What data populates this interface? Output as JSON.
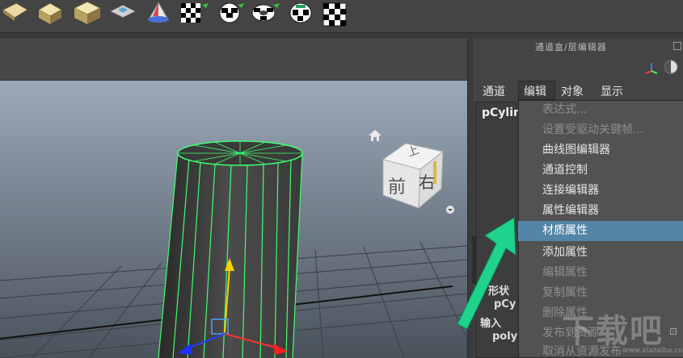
{
  "shelf": {
    "icons": [
      "plane-icon",
      "box-icon",
      "cylinder-icon",
      "uv-plane-icon",
      "cone-icon",
      "checker-uv-icon",
      "checker-sphere-icon",
      "checker-torus-icon",
      "checker-cylinder-icon",
      "checker-square-icon"
    ]
  },
  "channel_box": {
    "title": "通道盒/层编辑器",
    "menus": [
      "通道",
      "编辑",
      "对象",
      "显示"
    ],
    "object_name": "pCylin",
    "shape_label": "形状",
    "shape_name": "pCy",
    "inputs_label": "输入",
    "input_name": "poly"
  },
  "view_cube": {
    "top_label": "上",
    "front_label": "前",
    "right_label": "右"
  },
  "edit_menu": {
    "items": [
      {
        "label": "表达式...",
        "disabled": true
      },
      {
        "label": "设置受驱动关键帧...",
        "disabled": true
      },
      {
        "label": "曲线图编辑器",
        "disabled": false
      },
      {
        "label": "通道控制",
        "disabled": false
      },
      {
        "label": "连接编辑器",
        "disabled": false
      },
      {
        "label": "属性编辑器",
        "disabled": false
      },
      {
        "label": "材质属性",
        "disabled": false,
        "highlighted": true
      },
      {
        "label": "添加属性",
        "disabled": false
      },
      {
        "label": "编辑属性",
        "disabled": true
      },
      {
        "label": "复制属性",
        "disabled": true
      },
      {
        "label": "删除属性",
        "disabled": true
      },
      {
        "label": "发布到资源",
        "disabled": true
      },
      {
        "label": "取消从资源发布",
        "disabled": true
      }
    ]
  },
  "watermark": {
    "text": "下载吧",
    "url": "www.xiazaiba.com"
  },
  "colors": {
    "highlight": "#5285a6",
    "wireframe": "#40ff70",
    "arrow": "#1fd38c"
  }
}
